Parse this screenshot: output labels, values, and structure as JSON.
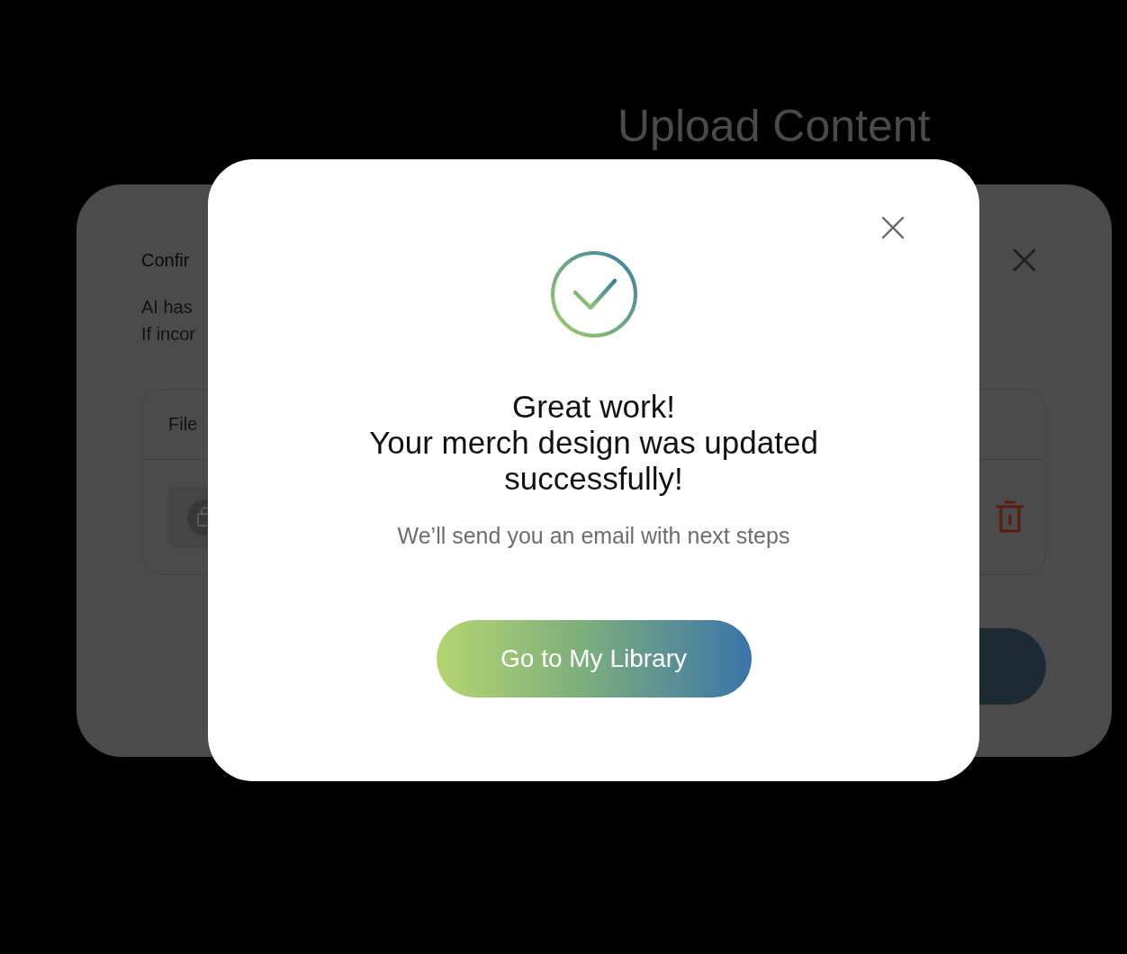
{
  "page": {
    "title": "Upload Content"
  },
  "background_dialog": {
    "title": "Confir",
    "description": [
      "AI has",
      "If incor"
    ],
    "table": {
      "columns": [
        "File"
      ],
      "rows": [
        {
          "kind": "file"
        }
      ]
    }
  },
  "success_dialog": {
    "title": "Great work!",
    "message": "Your merch design was updated successfully!",
    "subtitle": "We’ll send you an email with next steps",
    "button": "Go to My Library"
  }
}
